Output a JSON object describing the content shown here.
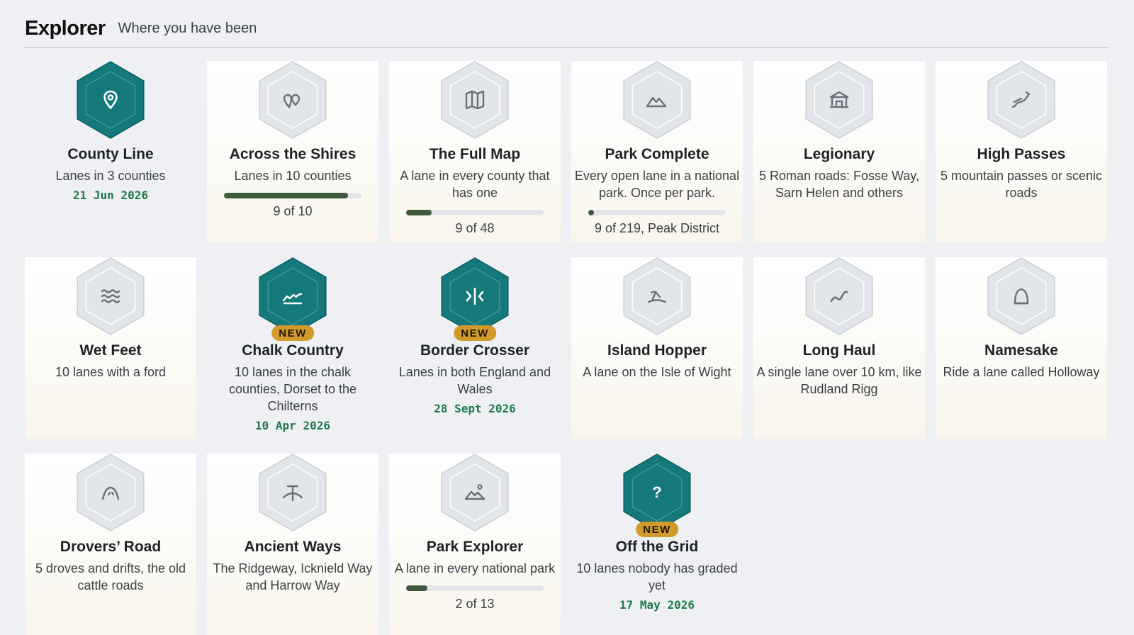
{
  "header": {
    "title": "Explorer",
    "subtitle": "Where you have been"
  },
  "colors": {
    "earned_hex": "#15787b",
    "locked_hex": "#e2e5ea",
    "new_badge": "#d29a2a",
    "date_text": "#1f7a4d",
    "progress_fill": "#3e5a3c"
  },
  "badges": [
    {
      "name": "County Line",
      "desc": "Lanes in 3 counties",
      "earned": true,
      "icon": "map-pin-icon",
      "date": "21 Jun 2026"
    },
    {
      "name": "Across the Shires",
      "desc": "Lanes in 10 counties",
      "earned": false,
      "icon": "heart-pins-icon",
      "progress": 0.9,
      "progress_label": "9 of 10"
    },
    {
      "name": "The Full Map",
      "desc": "A lane in every county that has one",
      "earned": false,
      "icon": "folded-map-icon",
      "progress": 0.1875,
      "progress_label": "9 of 48"
    },
    {
      "name": "Park Complete",
      "desc": "Every open lane in a national park. Once per park.",
      "earned": false,
      "icon": "mountain-icon",
      "progress": 0.04,
      "progress_label": "9 of 219, Peak District"
    },
    {
      "name": "Legionary",
      "desc": "5 Roman roads: Fosse Way, Sarn Helen and others",
      "earned": false,
      "icon": "temple-icon"
    },
    {
      "name": "High Passes",
      "desc": "5 mountain passes or scenic roads",
      "earned": false,
      "icon": "winding-road-icon"
    },
    {
      "name": "Wet Feet",
      "desc": "10 lanes with a ford",
      "earned": false,
      "icon": "water-waves-icon"
    },
    {
      "name": "Chalk Country",
      "desc": "10 lanes in the chalk counties, Dorset to the Chilterns",
      "earned": true,
      "new": true,
      "new_label": "NEW",
      "icon": "chalk-hills-icon",
      "date": "10 Apr 2026"
    },
    {
      "name": "Border Crosser",
      "desc": "Lanes in both England and Wales",
      "earned": true,
      "new": true,
      "new_label": "NEW",
      "icon": "border-arrows-icon",
      "date": "28 Sept 2026"
    },
    {
      "name": "Island Hopper",
      "desc": "A lane on the Isle of Wight",
      "earned": false,
      "icon": "island-icon"
    },
    {
      "name": "Long Haul",
      "desc": "A single lane over 10 km, like Rudland Rigg",
      "earned": false,
      "icon": "long-road-icon"
    },
    {
      "name": "Namesake",
      "desc": "Ride a lane called Holloway",
      "earned": false,
      "icon": "arch-icon"
    },
    {
      "name": "Drovers’ Road",
      "desc": "5 droves and drifts, the old cattle roads",
      "earned": false,
      "icon": "hill-track-icon"
    },
    {
      "name": "Ancient Ways",
      "desc": "The Ridgeway, Icknield Way and Harrow Way",
      "earned": false,
      "icon": "ancient-crossroads-icon"
    },
    {
      "name": "Park Explorer",
      "desc": "A lane in every national park",
      "earned": false,
      "icon": "landscape-icon",
      "progress": 0.1538,
      "progress_label": "2 of 13"
    },
    {
      "name": "Off the Grid",
      "desc": "10 lanes nobody has graded yet",
      "earned": true,
      "new": true,
      "new_label": "NEW",
      "icon": "question-mark-icon",
      "date": "17 May 2026"
    }
  ]
}
